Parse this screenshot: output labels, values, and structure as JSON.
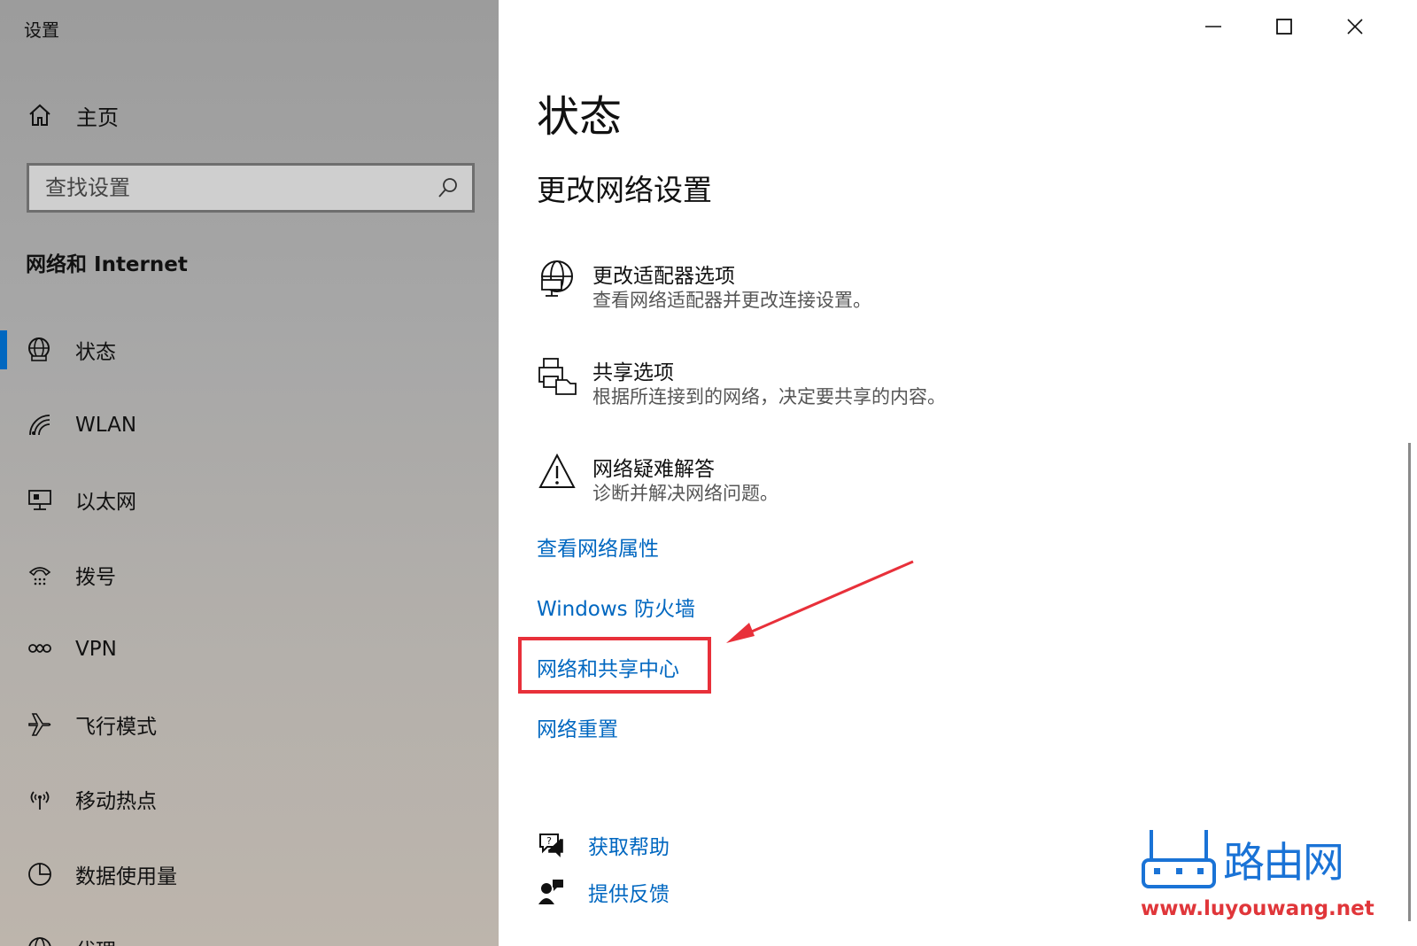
{
  "app": {
    "title": "设置"
  },
  "sidebar": {
    "home_label": "主页",
    "search_placeholder": "查找设置",
    "section_title": "网络和 Internet",
    "items": [
      {
        "label": "状态",
        "icon": "globe-icon",
        "active": true
      },
      {
        "label": "WLAN",
        "icon": "wifi-icon"
      },
      {
        "label": "以太网",
        "icon": "ethernet-icon"
      },
      {
        "label": "拨号",
        "icon": "dialup-icon"
      },
      {
        "label": "VPN",
        "icon": "vpn-icon"
      },
      {
        "label": "飞行模式",
        "icon": "airplane-icon"
      },
      {
        "label": "移动热点",
        "icon": "hotspot-icon"
      },
      {
        "label": "数据使用量",
        "icon": "data-usage-icon"
      },
      {
        "label": "代理",
        "icon": "globe-icon"
      }
    ]
  },
  "main": {
    "title": "状态",
    "subtitle": "更改网络设置",
    "settings": [
      {
        "title": "更改适配器选项",
        "desc": "查看网络适配器并更改连接设置。",
        "icon": "adapter-globe-icon"
      },
      {
        "title": "共享选项",
        "desc": "根据所连接到的网络，决定要共享的内容。",
        "icon": "sharing-icon"
      },
      {
        "title": "网络疑难解答",
        "desc": "诊断并解决网络问题。",
        "icon": "warning-icon"
      }
    ],
    "links": {
      "properties": "查看网络属性",
      "firewall": "Windows 防火墙",
      "sharing_center": "网络和共享中心",
      "reset": "网络重置"
    },
    "help": {
      "get_help": "获取帮助",
      "feedback": "提供反馈"
    }
  },
  "watermark": {
    "chars": "路由网",
    "url": "www.luyouwang.net"
  },
  "colors": {
    "accent": "#0067c0",
    "annotation": "#e8303a",
    "watermark_blue": "#1a73d6",
    "watermark_red": "#e0363a"
  }
}
